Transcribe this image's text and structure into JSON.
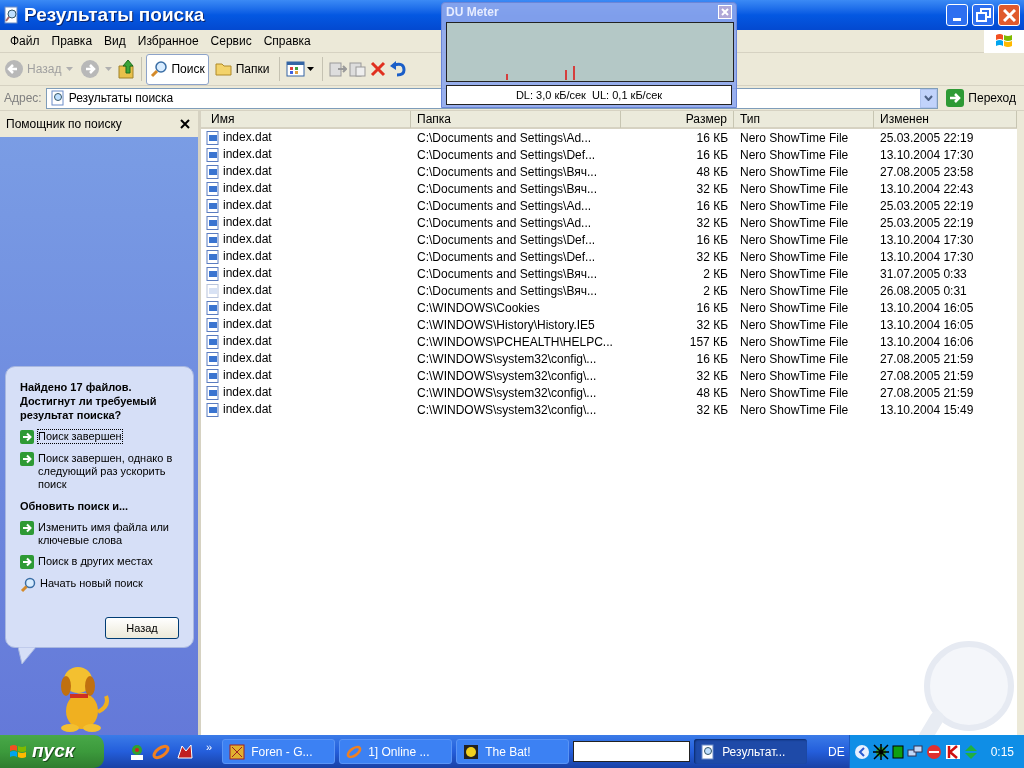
{
  "window": {
    "title": "Результаты поиска"
  },
  "menu": [
    "Файл",
    "Правка",
    "Вид",
    "Избранное",
    "Сервис",
    "Справка"
  ],
  "toolbar": {
    "back": {
      "label": "Назад",
      "disabled": true
    },
    "search": {
      "label": "Поиск",
      "selected": true
    },
    "folders": {
      "label": "Папки",
      "selected": false
    }
  },
  "address": {
    "label": "Адрес:",
    "value": "Результаты поиска",
    "go": "Переход"
  },
  "du_meter": {
    "title": "DU Meter",
    "reading": "DL: 3,0 кБ/сек  UL: 0,1 кБ/сек"
  },
  "search_pane": {
    "title": "Помощник по поиску",
    "heading": "Найдено 17 файлов. Достигнут ли требуемый результат поиска?",
    "links": [
      {
        "kind": "arrow",
        "label": "Поиск завершен",
        "focused": true
      },
      {
        "kind": "arrow",
        "label": "Поиск завершен, однако в следующий раз ускорить поиск",
        "focused": false
      }
    ],
    "section": "Обновить поиск и...",
    "links2": [
      {
        "kind": "arrow",
        "label": "Изменить имя файла или ключевые слова",
        "focused": false
      },
      {
        "kind": "arrow",
        "label": "Поиск в других местах",
        "focused": false
      },
      {
        "kind": "search",
        "label": "Начать новый поиск",
        "focused": false
      }
    ],
    "button": "Назад"
  },
  "table": {
    "columns": [
      "Имя",
      "Папка",
      "Размер",
      "Тип",
      "Изменен"
    ],
    "rows": [
      {
        "name": "index.dat",
        "folder": "C:\\Documents and Settings\\Ad...",
        "size": "16 КБ",
        "type": "Nero ShowTime File",
        "modified": "25.03.2005 22:19",
        "dimmed": false
      },
      {
        "name": "index.dat",
        "folder": "C:\\Documents and Settings\\Def...",
        "size": "16 КБ",
        "type": "Nero ShowTime File",
        "modified": "13.10.2004 17:30",
        "dimmed": false
      },
      {
        "name": "index.dat",
        "folder": "C:\\Documents and Settings\\Вяч...",
        "size": "48 КБ",
        "type": "Nero ShowTime File",
        "modified": "27.08.2005 23:58",
        "dimmed": false
      },
      {
        "name": "index.dat",
        "folder": "C:\\Documents and Settings\\Вяч...",
        "size": "32 КБ",
        "type": "Nero ShowTime File",
        "modified": "13.10.2004 22:43",
        "dimmed": false
      },
      {
        "name": "index.dat",
        "folder": "C:\\Documents and Settings\\Ad...",
        "size": "16 КБ",
        "type": "Nero ShowTime File",
        "modified": "25.03.2005 22:19",
        "dimmed": false
      },
      {
        "name": "index.dat",
        "folder": "C:\\Documents and Settings\\Ad...",
        "size": "32 КБ",
        "type": "Nero ShowTime File",
        "modified": "25.03.2005 22:19",
        "dimmed": false
      },
      {
        "name": "index.dat",
        "folder": "C:\\Documents and Settings\\Def...",
        "size": "16 КБ",
        "type": "Nero ShowTime File",
        "modified": "13.10.2004 17:30",
        "dimmed": false
      },
      {
        "name": "index.dat",
        "folder": "C:\\Documents and Settings\\Def...",
        "size": "32 КБ",
        "type": "Nero ShowTime File",
        "modified": "13.10.2004 17:30",
        "dimmed": false
      },
      {
        "name": "index.dat",
        "folder": "C:\\Documents and Settings\\Вяч...",
        "size": "2 КБ",
        "type": "Nero ShowTime File",
        "modified": "31.07.2005 0:33",
        "dimmed": false
      },
      {
        "name": "index.dat",
        "folder": "C:\\Documents and Settings\\Вяч...",
        "size": "2 КБ",
        "type": "Nero ShowTime File",
        "modified": "26.08.2005 0:31",
        "dimmed": true
      },
      {
        "name": "index.dat",
        "folder": "C:\\WINDOWS\\Cookies",
        "size": "16 КБ",
        "type": "Nero ShowTime File",
        "modified": "13.10.2004 16:05",
        "dimmed": false
      },
      {
        "name": "index.dat",
        "folder": "C:\\WINDOWS\\History\\History.IE5",
        "size": "32 КБ",
        "type": "Nero ShowTime File",
        "modified": "13.10.2004 16:05",
        "dimmed": false
      },
      {
        "name": "index.dat",
        "folder": "C:\\WINDOWS\\PCHEALTH\\HELPC...",
        "size": "157 КБ",
        "type": "Nero ShowTime File",
        "modified": "13.10.2004 16:06",
        "dimmed": false
      },
      {
        "name": "index.dat",
        "folder": "C:\\WINDOWS\\system32\\config\\...",
        "size": "16 КБ",
        "type": "Nero ShowTime File",
        "modified": "27.08.2005 21:59",
        "dimmed": false
      },
      {
        "name": "index.dat",
        "folder": "C:\\WINDOWS\\system32\\config\\...",
        "size": "32 КБ",
        "type": "Nero ShowTime File",
        "modified": "27.08.2005 21:59",
        "dimmed": false
      },
      {
        "name": "index.dat",
        "folder": "C:\\WINDOWS\\system32\\config\\...",
        "size": "48 КБ",
        "type": "Nero ShowTime File",
        "modified": "27.08.2005 21:59",
        "dimmed": false
      },
      {
        "name": "index.dat",
        "folder": "C:\\WINDOWS\\system32\\config\\...",
        "size": "32 КБ",
        "type": "Nero ShowTime File",
        "modified": "13.10.2004 15:49",
        "dimmed": false
      }
    ]
  },
  "taskbar": {
    "start": "пуск",
    "more": "»",
    "tasks": [
      {
        "label": "Foren - G...",
        "selected": false
      },
      {
        "label": "1] Online ...",
        "selected": false
      },
      {
        "label": "The Bat!",
        "selected": false
      },
      {
        "label": "Результат...",
        "selected": true
      }
    ],
    "language": "DE",
    "clock": "0:15"
  }
}
